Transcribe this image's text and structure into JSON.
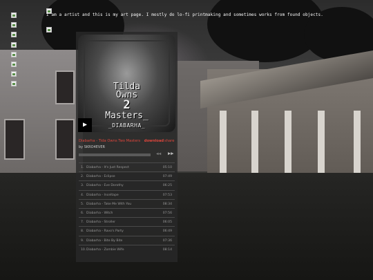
{
  "bio_text": "I am a artist and this is my art page. I mostly do lo-fi printmaking and sometimes works from found objects.",
  "nav_items": [
    "nav-1",
    "nav-2",
    "nav-3",
    "nav-4",
    "nav-5",
    "nav-6",
    "nav-7",
    "nav-8"
  ],
  "player": {
    "art_lines": [
      "Tilda",
      "Owns",
      "2",
      "Masters_",
      "_DIABARHA_"
    ],
    "album_title": "Diabarha - Tida Owns Two Masters",
    "download_label": "download",
    "share_label": "share",
    "byline": "by SKRO4EVER",
    "progress": 0,
    "tracks": [
      {
        "num": "1.",
        "title": "Diabarha - It's Just Respect",
        "duration": "05:10"
      },
      {
        "num": "2.",
        "title": "Diabarha - Eclipse",
        "duration": "07:49"
      },
      {
        "num": "3.",
        "title": "Diabarha - Eve Dorothy",
        "duration": "06:25"
      },
      {
        "num": "4.",
        "title": "Diabarha - Inceltape",
        "duration": "07:53"
      },
      {
        "num": "5.",
        "title": "Diabarha - Take Me With You",
        "duration": "08:34"
      },
      {
        "num": "6.",
        "title": "Diabarha - Witch",
        "duration": "07:56"
      },
      {
        "num": "7.",
        "title": "Diabarha - Stroller",
        "duration": "06:05"
      },
      {
        "num": "8.",
        "title": "Diabarha - Ravo's Party",
        "duration": "06:49"
      },
      {
        "num": "9.",
        "title": "Diabarha - Bite By Bite",
        "duration": "07:36"
      },
      {
        "num": "10.",
        "title": "Diabarha - Zombie Wife",
        "duration": "08:14"
      }
    ]
  },
  "colors": {
    "accent": "#e0463c",
    "player_bg": "#282828"
  }
}
